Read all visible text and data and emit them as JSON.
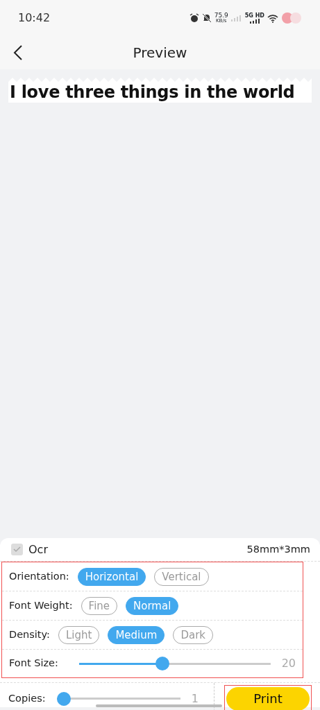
{
  "status_bar": {
    "time": "10:42",
    "speed": "75.9",
    "speed_unit": "KB/s",
    "network": "5G HD"
  },
  "header": {
    "title": "Preview"
  },
  "preview": {
    "text": "I love three things in the world"
  },
  "panel": {
    "ocr": {
      "label": "Ocr",
      "checked": true,
      "disabled": true
    },
    "size": "58mm*3mm",
    "options": [
      {
        "label": "Orientation:",
        "choices": [
          {
            "label": "Horizontal",
            "selected": true
          },
          {
            "label": "Vertical",
            "selected": false
          }
        ]
      },
      {
        "label": "Font Weight:",
        "choices": [
          {
            "label": "Fine",
            "selected": false
          },
          {
            "label": "Normal",
            "selected": true
          }
        ]
      },
      {
        "label": "Density:",
        "choices": [
          {
            "label": "Light",
            "selected": false
          },
          {
            "label": "Medium",
            "selected": true
          },
          {
            "label": "Dark",
            "selected": false
          }
        ]
      }
    ],
    "font_size": {
      "label": "Font Size:",
      "level": 0.43,
      "reading": "20"
    },
    "copies": {
      "label": "Copies:",
      "level": 0,
      "reading": "1"
    },
    "print_button": "Print"
  }
}
